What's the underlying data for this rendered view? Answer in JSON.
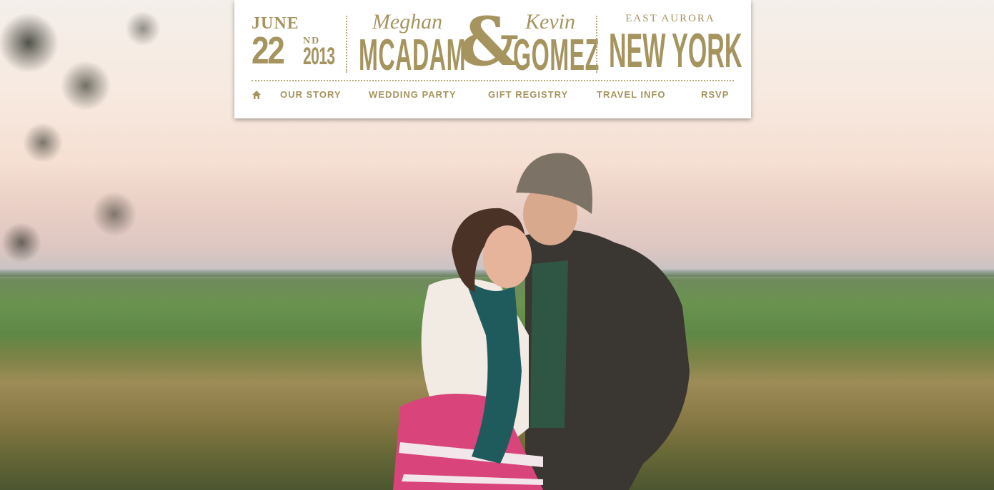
{
  "header": {
    "date": {
      "month": "JUNE",
      "day": "22",
      "suffix": "ND",
      "year": "2013"
    },
    "bride": {
      "first": "Meghan",
      "last": "MCADAM"
    },
    "ampersand": "&",
    "groom": {
      "first": "Kevin",
      "last": "GOMEZ"
    },
    "location": {
      "city": "EAST AURORA",
      "state": "NEW YORK"
    }
  },
  "nav": {
    "home_icon": "home-icon",
    "items": [
      {
        "label": "OUR STORY"
      },
      {
        "label": "WEDDING PARTY"
      },
      {
        "label": "GIFT REGISTRY"
      },
      {
        "label": "TRAVEL INFO"
      },
      {
        "label": "RSVP"
      }
    ]
  },
  "colors": {
    "accent": "#a6945f",
    "card_bg": "#ffffff"
  }
}
